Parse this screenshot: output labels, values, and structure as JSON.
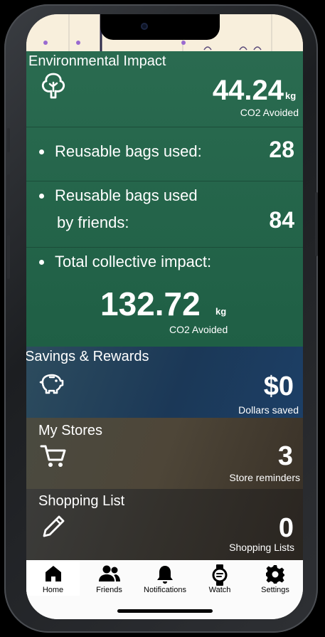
{
  "environmental": {
    "title": "Environmental Impact",
    "icon": "tree-icon",
    "co2_value": "44.24",
    "co2_unit": "kg",
    "co2_caption": "CO2 Avoided",
    "bags_used_label": "Reusable bags used:",
    "bags_used_value": "28",
    "friends_bags_label_line1": "Reusable bags used",
    "friends_bags_label_line2": "by friends:",
    "friends_bags_value": "84",
    "collective_label": "Total collective impact:",
    "collective_value": "132.72",
    "collective_unit": "kg",
    "collective_caption": "CO2 Avoided"
  },
  "savings": {
    "title": "Savings & Rewards",
    "icon": "piggy-bank-icon",
    "value": "$0",
    "caption": "Dollars saved"
  },
  "stores": {
    "title": "My Stores",
    "icon": "cart-icon",
    "value": "3",
    "caption": "Store reminders"
  },
  "shopping": {
    "title": "Shopping List",
    "icon": "pencil-icon",
    "value": "0",
    "caption": "Shopping Lists"
  },
  "nav": {
    "items": [
      {
        "label": "Home",
        "icon": "home-icon",
        "active": true
      },
      {
        "label": "Friends",
        "icon": "friends-icon",
        "active": false
      },
      {
        "label": "Notifications",
        "icon": "bell-icon",
        "active": false
      },
      {
        "label": "Watch",
        "icon": "watch-icon",
        "active": false
      },
      {
        "label": "Settings",
        "icon": "gear-icon",
        "active": false
      }
    ]
  },
  "colors": {
    "environmental_bg": "#266650",
    "savings_bg": "#1e3b5c",
    "stores_bg": "#4a4436",
    "shopping_bg": "#35312c"
  }
}
